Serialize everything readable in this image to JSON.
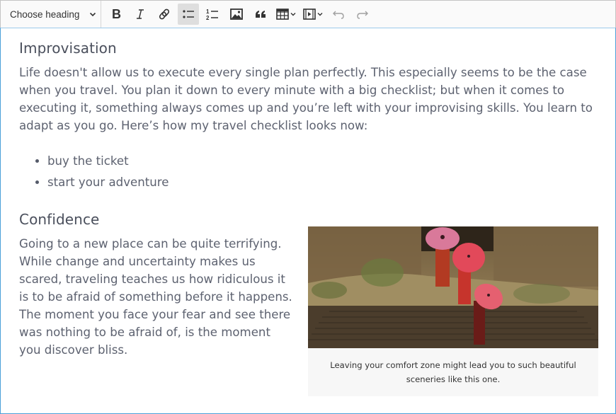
{
  "toolbar": {
    "heading_dropdown": {
      "label": "Choose heading",
      "icon": "chevron-down-icon"
    },
    "buttons": [
      {
        "name": "bold",
        "icon": "bold-icon",
        "active": false
      },
      {
        "name": "italic",
        "icon": "italic-icon",
        "active": false
      },
      {
        "name": "link",
        "icon": "link-icon",
        "active": false
      },
      {
        "name": "bulleted-list",
        "icon": "bulleted-list-icon",
        "active": true
      },
      {
        "name": "numbered-list",
        "icon": "numbered-list-icon",
        "active": false
      },
      {
        "name": "insert-image",
        "icon": "image-icon",
        "active": false
      },
      {
        "name": "block-quote",
        "icon": "quote-icon",
        "active": false
      },
      {
        "name": "insert-table",
        "icon": "table-icon",
        "active": false,
        "dropdown": true
      },
      {
        "name": "insert-media",
        "icon": "media-icon",
        "active": false,
        "dropdown": true
      },
      {
        "name": "undo",
        "icon": "undo-icon",
        "active": false,
        "disabled": true
      },
      {
        "name": "redo",
        "icon": "redo-icon",
        "active": false,
        "disabled": true
      }
    ]
  },
  "document": {
    "section1": {
      "heading": "Improvisation",
      "paragraph": "Life doesn't allow us to execute every single plan perfectly. This especially seems to be the case when you travel. You plan it down to every minute with a big checklist; but when it comes to executing it, something always comes up and you’re left with your improvising skills. You learn to adapt as you go. Here’s how my travel checklist looks now:",
      "list": [
        "buy the ticket",
        "start your adventure"
      ]
    },
    "section2": {
      "heading": "Confidence",
      "paragraph": "Going to a new place can be quite terrifying. While change and uncertainty makes us scared, traveling teaches us how ridiculous it is to be afraid of something before it happens. The moment you face your fear and see there was nothing to be afraid of, is the moment you discover bliss.",
      "figure": {
        "image_alt": "Monks with red umbrellas walking up temple steps",
        "caption": "Leaving your comfort zone might lead you to such beautiful sceneries like this one."
      }
    }
  },
  "colors": {
    "focus_border": "#4a9fd8",
    "toolbar_bg": "#fafafa",
    "active_button_bg": "#dedede",
    "text": "#5d6270"
  }
}
